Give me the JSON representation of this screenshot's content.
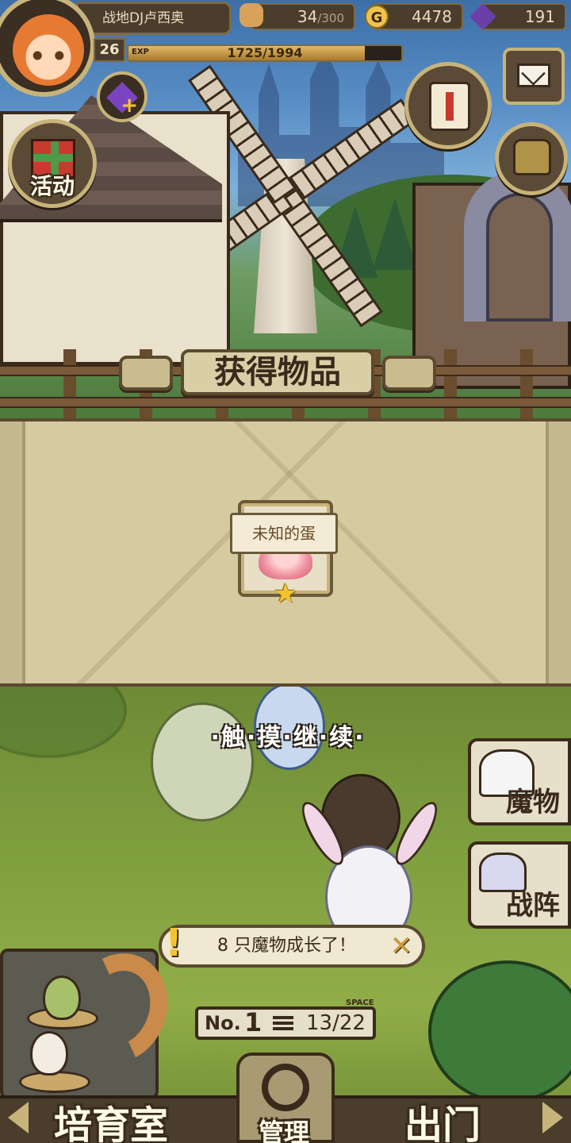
{
  "player": {
    "name": "战地DJ卢西奥",
    "level": "26",
    "exp_label": "EXP",
    "exp_text": "1725/1994",
    "exp_fraction": 0.865
  },
  "resources": {
    "stamina": "34",
    "stamina_max": "/300",
    "gold": "4478",
    "gold_icon_text": "G",
    "gems": "191"
  },
  "buttons": {
    "event": "活动"
  },
  "reward": {
    "title": "获得物品",
    "item_name": "未知的蛋",
    "stars": "★"
  },
  "field": {
    "touch_hint": "·触·摸·继·续·",
    "side_monster": "魔物",
    "side_formation": "战阵",
    "notification": "8 只魔物成长了！",
    "notification_icon": "!",
    "close": "✕",
    "slot_no": "No.",
    "slot_num": "1",
    "slot_count": "13/22",
    "space_label": "SPACE"
  },
  "bottom": {
    "nursery": "培育室",
    "manage": "管理",
    "go_out": "出门"
  },
  "icons": {
    "avatar": "avatar",
    "stamina": "bread-icon",
    "gold": "gold-coin-icon",
    "gem": "gem-icon",
    "gem_add": "gem-plus-icon",
    "event": "gift-icon",
    "quest": "scroll-icon",
    "mail": "mail-icon",
    "bag": "bag-icon",
    "star": "star-icon",
    "close": "close-icon",
    "menu": "menu-icon"
  },
  "colors": {
    "panel": "#d6cba0",
    "border": "#5b4a2e",
    "accent": "#f4c430"
  }
}
